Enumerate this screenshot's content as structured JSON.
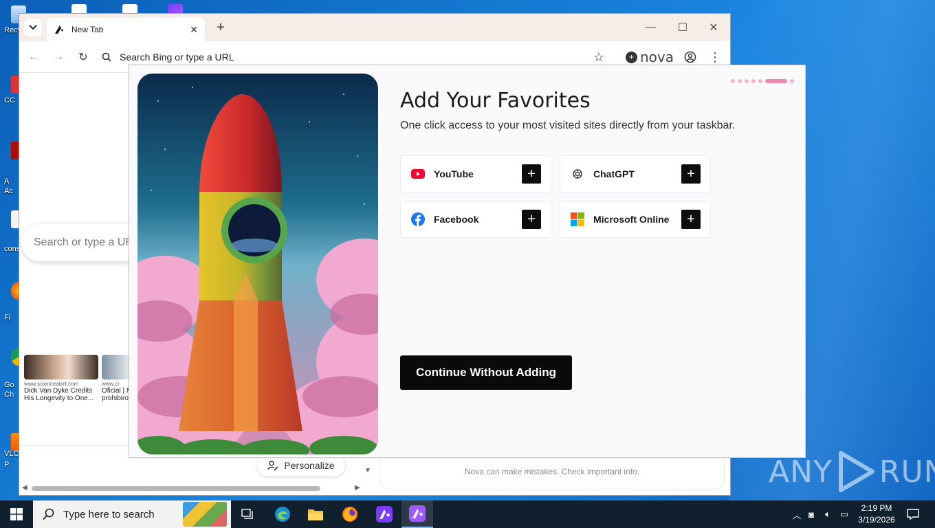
{
  "desktop": {
    "icons": [
      "Recy",
      "CC",
      "A\nAc",
      "cons",
      "Fi",
      "Go\nCh",
      "VLC\nP"
    ],
    "watermark": "ANY RUN"
  },
  "browser": {
    "tab_title": "New Tab",
    "address_placeholder": "Search Bing or type a URL",
    "brand": "nova",
    "ntp_search_placeholder": "Search or type a URL",
    "news": [
      {
        "source": "www.sciencealert.com",
        "headline1": "Dick Van Dyke Credits",
        "headline2": "His Longevity to One..."
      },
      {
        "source": "www.cr",
        "headline1": "Oficial | M",
        "headline2": "prohibiro"
      }
    ],
    "personalize_label": "Personalize",
    "nova_disclaimer": "Nova can make mistakes. Check important info."
  },
  "modal": {
    "title": "Add Your Favorites",
    "subtitle": "One click access to your most visited sites directly from your taskbar.",
    "favorites": [
      {
        "name": "YouTube",
        "icon": "youtube-icon"
      },
      {
        "name": "ChatGPT",
        "icon": "chatgpt-icon"
      },
      {
        "name": "Facebook",
        "icon": "facebook-icon"
      },
      {
        "name": "Microsoft Online",
        "icon": "microsoft-icon"
      }
    ],
    "continue_label": "Continue Without Adding",
    "progress_steps": 7,
    "progress_active": 6
  },
  "taskbar": {
    "search_placeholder": "Type here to search",
    "time": "2:19 PM",
    "date": "3/19/2026"
  },
  "colors": {
    "accent_pink": "#f08ab0",
    "button_black": "#0a0a0a",
    "taskbar": "#10202e"
  }
}
